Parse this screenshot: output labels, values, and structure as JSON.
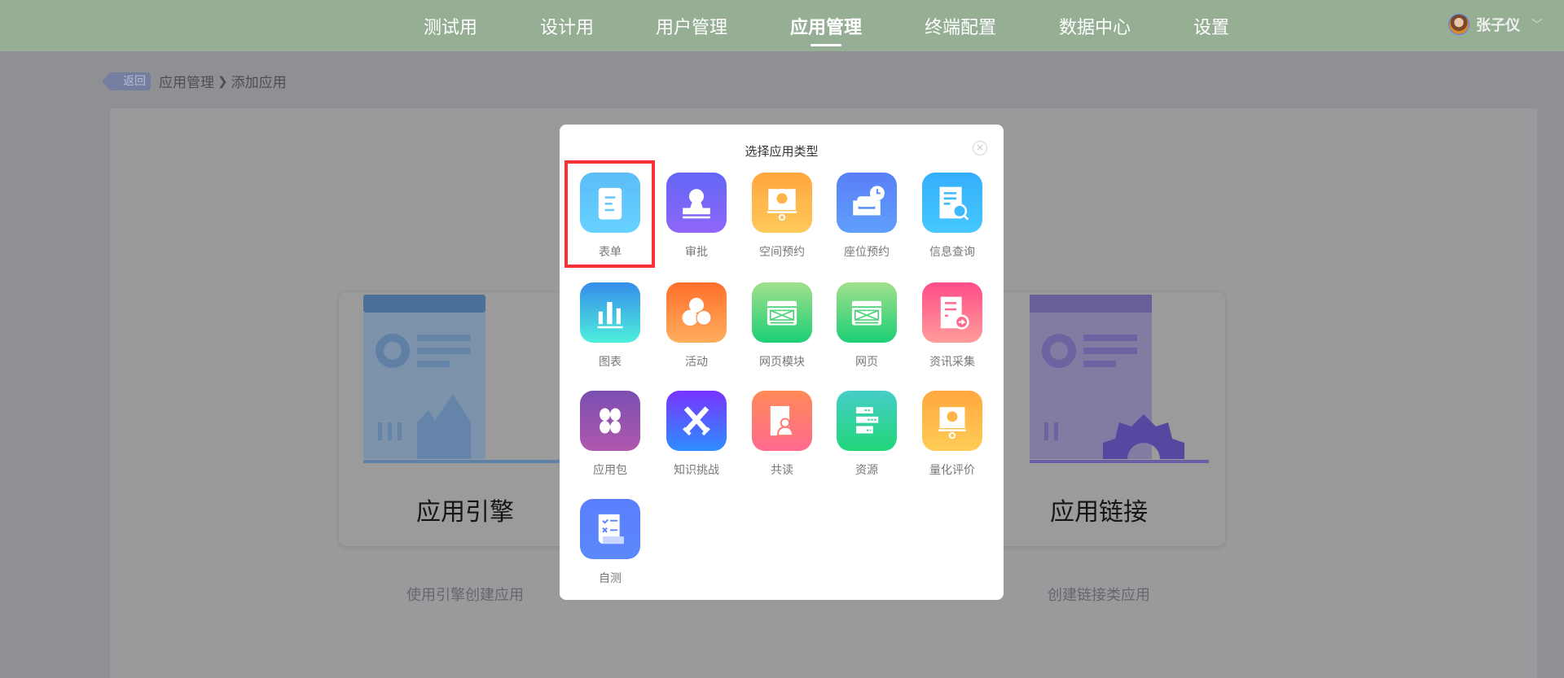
{
  "header": {
    "nav": [
      {
        "label": "测试用",
        "active": false
      },
      {
        "label": "设计用",
        "active": false
      },
      {
        "label": "用户管理",
        "active": false
      },
      {
        "label": "应用管理",
        "active": true
      },
      {
        "label": "终端配置",
        "active": false
      },
      {
        "label": "数据中心",
        "active": false
      },
      {
        "label": "设置",
        "active": false
      }
    ],
    "user": {
      "name": "张子仪"
    }
  },
  "breadcrumb": {
    "back": "返回",
    "parent": "应用管理",
    "separator": "❯",
    "current": "添加应用"
  },
  "cards": [
    {
      "title": "应用引擎",
      "subtitle": "使用引擎创建应用"
    },
    {
      "title": "",
      "subtitle": ""
    },
    {
      "title": "应用链接",
      "subtitle": "创建链接类应用"
    }
  ],
  "modal": {
    "title": "选择应用类型",
    "close": "×",
    "selected": "表单",
    "types": [
      {
        "label": "表单",
        "icon": "form-icon",
        "colors": [
          "#5bbcf8",
          "#66d2ff"
        ]
      },
      {
        "label": "审批",
        "icon": "stamp-icon",
        "colors": [
          "#6366f6",
          "#8f66f8"
        ]
      },
      {
        "label": "空间预约",
        "icon": "presentation-icon",
        "colors": [
          "#ffa63c",
          "#ffc95a"
        ]
      },
      {
        "label": "座位预约",
        "icon": "seat-clock-icon",
        "colors": [
          "#5a7ef8",
          "#5ea0fb"
        ]
      },
      {
        "label": "信息查询",
        "icon": "document-search-icon",
        "colors": [
          "#33affb",
          "#47c8ff"
        ]
      },
      {
        "label": "图表",
        "icon": "bar-chart-icon",
        "colors": [
          "#358dea",
          "#4eeedc"
        ]
      },
      {
        "label": "活动",
        "icon": "circles-icon",
        "colors": [
          "#ff6f2a",
          "#ffae5e"
        ]
      },
      {
        "label": "网页模块",
        "icon": "webpage-module-icon",
        "colors": [
          "#a0e08c",
          "#1ccf75"
        ]
      },
      {
        "label": "网页",
        "icon": "webpage-icon",
        "colors": [
          "#a0e08c",
          "#1ccf75"
        ]
      },
      {
        "label": "资讯采集",
        "icon": "news-collect-icon",
        "colors": [
          "#ff4c88",
          "#ff9d9a"
        ]
      },
      {
        "label": "应用包",
        "icon": "clover-icon",
        "colors": [
          "#7a4fb0",
          "#b058ae"
        ]
      },
      {
        "label": "知识挑战",
        "icon": "crossed-swords-icon",
        "colors": [
          "#7834ff",
          "#2e8eff"
        ]
      },
      {
        "label": "共读",
        "icon": "reading-group-icon",
        "colors": [
          "#ff8a58",
          "#ff6a8e"
        ]
      },
      {
        "label": "资源",
        "icon": "server-icon",
        "colors": [
          "#45cdc8",
          "#22d677"
        ]
      },
      {
        "label": "量化评价",
        "icon": "evaluation-icon",
        "colors": [
          "#ffa83e",
          "#ffcc56"
        ]
      },
      {
        "label": "自测",
        "icon": "checklist-scroll-icon",
        "colors": [
          "#5b7ffe",
          "#5b88fb"
        ]
      }
    ]
  }
}
